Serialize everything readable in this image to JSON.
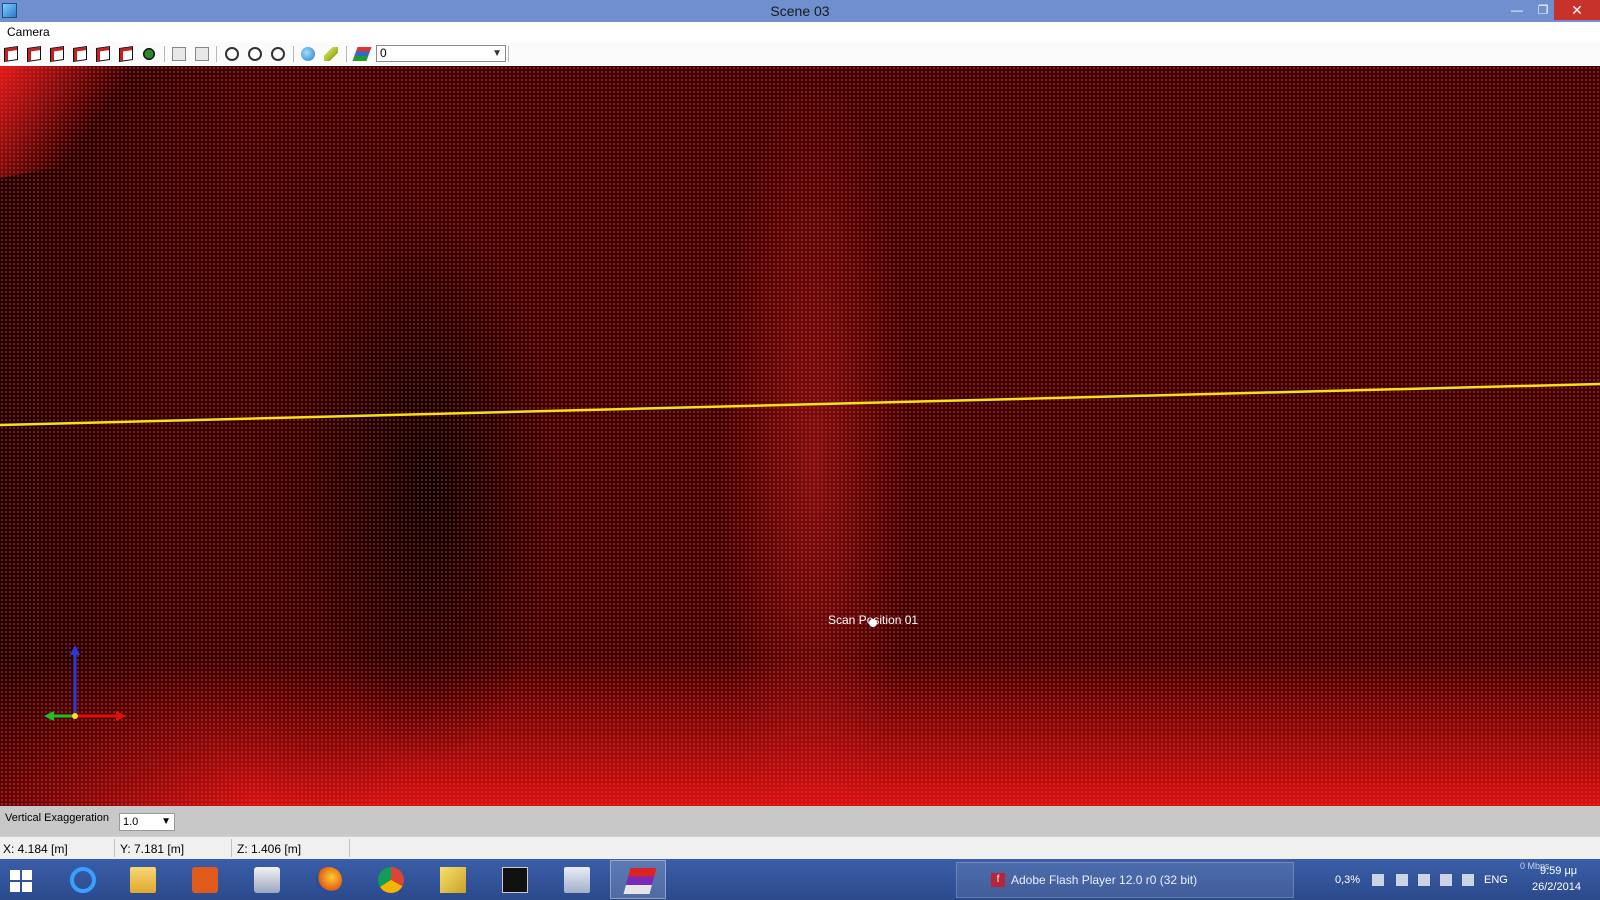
{
  "window": {
    "title": "Scene 03"
  },
  "menu": {
    "items": [
      "Camera"
    ]
  },
  "toolbar": {
    "layer_value": "0"
  },
  "viewport": {
    "scan_label": "Scan Position 01"
  },
  "vertical_exaggeration": {
    "label": "Vertical Exaggeration",
    "value": "1.0"
  },
  "status": {
    "x": "X: 4.184 [m]",
    "y": "Y: 7.181 [m]",
    "z": "Z: 1.406 [m]"
  },
  "taskbar": {
    "apps": [
      "start",
      "internet-explorer",
      "file-explorer",
      "office",
      "java",
      "firefox",
      "chrome",
      "app-folder",
      "command-prompt",
      "system-tool",
      "scan-app"
    ],
    "active_app": "scan-app",
    "flash_task_label": "Adobe Flash Player 12.0 r0 (32 bit)"
  },
  "tray": {
    "cpu": "0,3%",
    "language": "ENG",
    "clock_time": "9:59 μμ",
    "clock_date": "26/2/2014",
    "net": "0 Mbps"
  },
  "colors": {
    "title_bar": "#6f8fcf",
    "close_button": "#c7322b",
    "taskbar": "#2b4a8c",
    "point_cloud": "#e21b1b",
    "scan_line": "#f4e11a"
  }
}
